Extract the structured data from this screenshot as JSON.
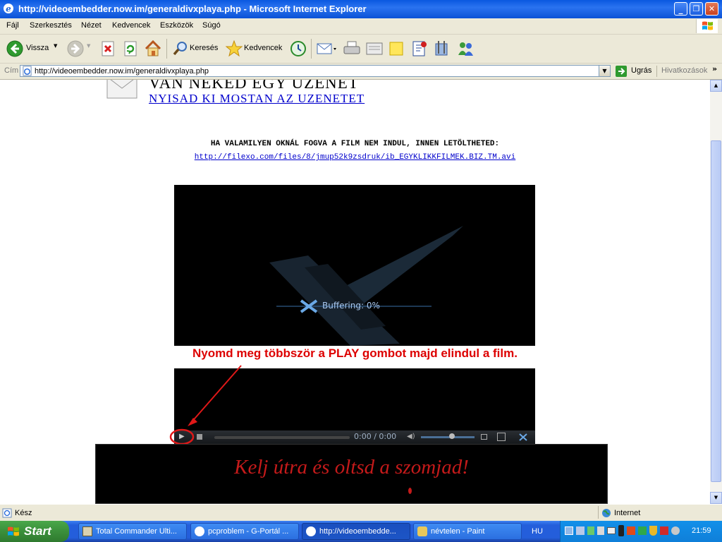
{
  "window": {
    "title": "http://videoembedder.now.im/generaldivxplaya.php - Microsoft Internet Explorer",
    "minimize": "_",
    "maximize": "❐",
    "close": "✕"
  },
  "menu": [
    "Fájl",
    "Szerkesztés",
    "Nézet",
    "Kedvencek",
    "Eszközök",
    "Súgó"
  ],
  "toolbar": {
    "back_label": "Vissza",
    "search_label": "Keresés",
    "favorites_label": "Kedvencek"
  },
  "address": {
    "label": "Cím",
    "url": "http://videoembedder.now.im/generaldivxplaya.php",
    "go_label": "Ugrás",
    "links_label": "Hivatkozások"
  },
  "page": {
    "banner_title": "VAN NEKED EGY UZENET",
    "banner_link": "NYISAD KI MOSTAN AZ UZENETET",
    "notice": "HA VALAMILYEN OKNÁL FOGVA A FILM NEM INDUL, INNEN LETÖLTHETED:",
    "download_link": "http://filexo.com/files/8/jmup52k9zsdruk/ib_EGYKLIKKFILMEK.BIZ.TM.avi",
    "buffering_text": "Buffering: 0%",
    "instruction": "Nyomd meg többször a PLAY gombot majd elindul a film.",
    "player_time": "0:00 / 0:00",
    "ad_text": "Kelj útra és oltsd a szomjad!"
  },
  "status": {
    "text": "Kész",
    "zone": "Internet"
  },
  "taskbar": {
    "start_label": "Start",
    "tasks": [
      {
        "label": "Total Commander Ulti...",
        "active": false
      },
      {
        "label": "pcproblem - G-Portál ...",
        "active": false
      },
      {
        "label": "http://videoembedde...",
        "active": true
      },
      {
        "label": "névtelen - Paint",
        "active": false
      }
    ],
    "language": "HU",
    "clock": "21:59"
  },
  "colors": {
    "title_bar": "#0a58e0",
    "chrome": "#ece9d8",
    "link": "#0000cc",
    "instruction_red": "#dd0000",
    "player_bg": "#000000",
    "taskbar": "#245edb",
    "start_green": "#3b8f3b"
  }
}
